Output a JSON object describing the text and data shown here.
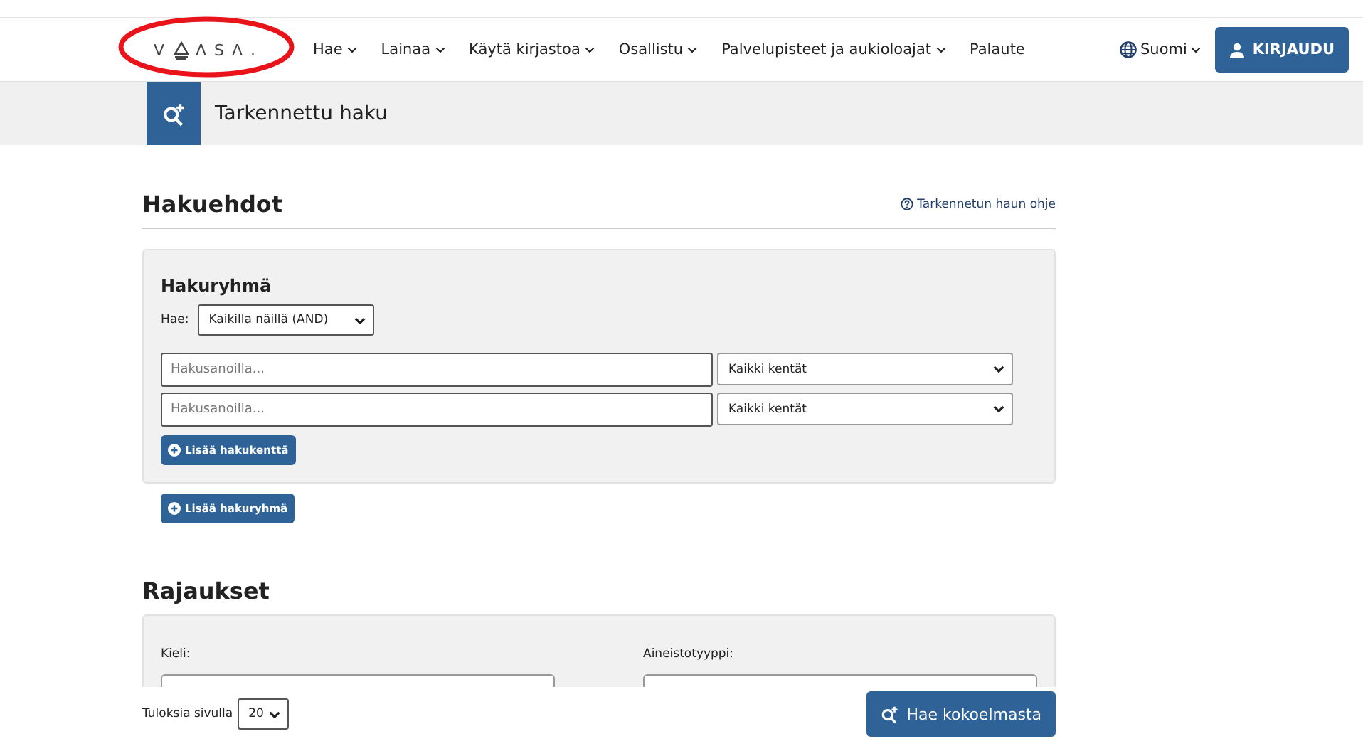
{
  "header": {
    "logo": {
      "before": "V",
      "after": "Λ S Λ ."
    },
    "annotation": {
      "shown": true
    },
    "nav": [
      {
        "label": "Hae",
        "dropdown": true
      },
      {
        "label": "Lainaa",
        "dropdown": true
      },
      {
        "label": "Käytä kirjastoa",
        "dropdown": true
      },
      {
        "label": "Osallistu",
        "dropdown": true
      },
      {
        "label": "Palvelupisteet ja aukioloajat",
        "dropdown": true
      },
      {
        "label": "Palaute",
        "dropdown": false
      }
    ],
    "language": "Suomi",
    "login": "KIRJAUDU"
  },
  "page_title": "Tarkennettu haku",
  "criteria": {
    "heading": "Hakuehdot",
    "help_link": "Tarkennetun haun ohje",
    "group": {
      "heading": "Hakuryhmä",
      "match_label": "Hae:",
      "match_value": "Kaikilla näillä (AND)",
      "rows": [
        {
          "placeholder": "Hakusanoilla...",
          "field": "Kaikki kentät"
        },
        {
          "placeholder": "Hakusanoilla...",
          "field": "Kaikki kentät"
        }
      ],
      "add_field": "Lisää hakukenttä"
    },
    "add_group": "Lisää hakuryhmä"
  },
  "limits": {
    "heading": "Rajaukset",
    "filters": [
      {
        "label": "Kieli:"
      },
      {
        "label": "Aineistotyyppi:"
      }
    ]
  },
  "footer": {
    "per_page_label": "Tuloksia sivulla",
    "per_page": "20",
    "search_button": "Hae kokoelmasta"
  }
}
